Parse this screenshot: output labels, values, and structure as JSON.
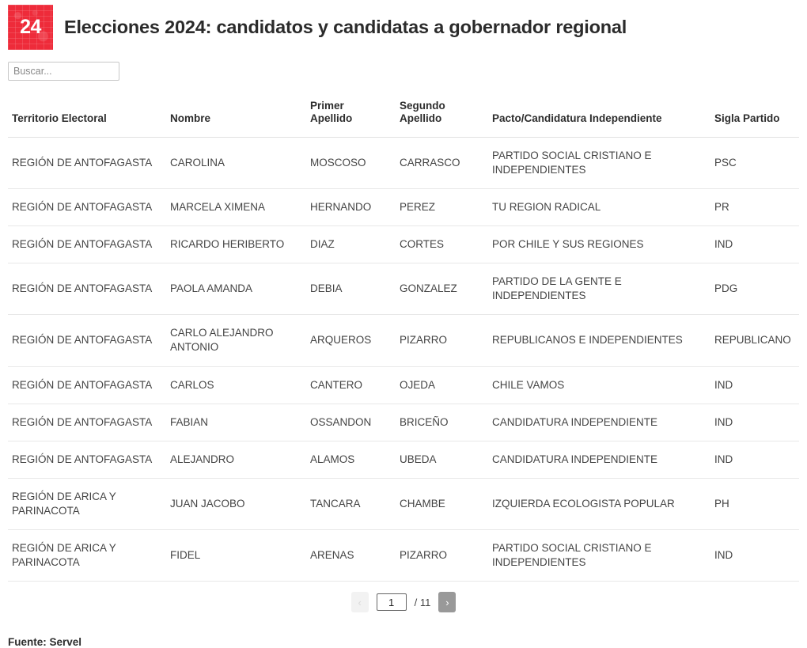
{
  "header": {
    "logo_text": "24",
    "logo_color": "#ee2b3a",
    "title": "Elecciones 2024: candidatos y candidatas a gobernador regional"
  },
  "search": {
    "value": "",
    "placeholder": "Buscar..."
  },
  "table": {
    "columns": [
      "Territorio Electoral",
      "Nombre",
      "Primer Apellido",
      "Segundo Apellido",
      "Pacto/Candidatura Independiente",
      "Sigla Partido"
    ],
    "rows": [
      {
        "territorio": "REGIÓN DE ANTOFAGASTA",
        "nombre": "CAROLINA",
        "primer_apellido": "MOSCOSO",
        "segundo_apellido": "CARRASCO",
        "pacto": "PARTIDO SOCIAL CRISTIANO E INDEPENDIENTES",
        "sigla": "PSC"
      },
      {
        "territorio": "REGIÓN DE ANTOFAGASTA",
        "nombre": "MARCELA XIMENA",
        "primer_apellido": "HERNANDO",
        "segundo_apellido": "PEREZ",
        "pacto": "TU REGION RADICAL",
        "sigla": "PR"
      },
      {
        "territorio": "REGIÓN DE ANTOFAGASTA",
        "nombre": "RICARDO HERIBERTO",
        "primer_apellido": "DIAZ",
        "segundo_apellido": "CORTES",
        "pacto": "POR CHILE Y SUS REGIONES",
        "sigla": "IND"
      },
      {
        "territorio": "REGIÓN DE ANTOFAGASTA",
        "nombre": "PAOLA AMANDA",
        "primer_apellido": "DEBIA",
        "segundo_apellido": "GONZALEZ",
        "pacto": "PARTIDO DE LA GENTE E INDEPENDIENTES",
        "sigla": "PDG"
      },
      {
        "territorio": "REGIÓN DE ANTOFAGASTA",
        "nombre": "CARLO ALEJANDRO ANTONIO",
        "primer_apellido": "ARQUEROS",
        "segundo_apellido": "PIZARRO",
        "pacto": "REPUBLICANOS E INDEPENDIENTES",
        "sigla": "REPUBLICANO"
      },
      {
        "territorio": "REGIÓN DE ANTOFAGASTA",
        "nombre": "CARLOS",
        "primer_apellido": "CANTERO",
        "segundo_apellido": "OJEDA",
        "pacto": "CHILE VAMOS",
        "sigla": "IND"
      },
      {
        "territorio": "REGIÓN DE ANTOFAGASTA",
        "nombre": "FABIAN",
        "primer_apellido": "OSSANDON",
        "segundo_apellido": "BRICEÑO",
        "pacto": "CANDIDATURA INDEPENDIENTE",
        "sigla": "IND"
      },
      {
        "territorio": "REGIÓN DE ANTOFAGASTA",
        "nombre": "ALEJANDRO",
        "primer_apellido": "ALAMOS",
        "segundo_apellido": "UBEDA",
        "pacto": "CANDIDATURA INDEPENDIENTE",
        "sigla": "IND"
      },
      {
        "territorio": "REGIÓN DE ARICA Y PARINACOTA",
        "nombre": "JUAN JACOBO",
        "primer_apellido": "TANCARA",
        "segundo_apellido": "CHAMBE",
        "pacto": "IZQUIERDA ECOLOGISTA POPULAR",
        "sigla": "PH"
      },
      {
        "territorio": "REGIÓN DE ARICA Y PARINACOTA",
        "nombre": "FIDEL",
        "primer_apellido": "ARENAS",
        "segundo_apellido": "PIZARRO",
        "pacto": "PARTIDO SOCIAL CRISTIANO E INDEPENDIENTES",
        "sigla": "IND"
      }
    ]
  },
  "pagination": {
    "prev_label": "‹",
    "next_label": "›",
    "current_page": "1",
    "total_label": "/ 11"
  },
  "footer": {
    "source": "Fuente: Servel"
  }
}
